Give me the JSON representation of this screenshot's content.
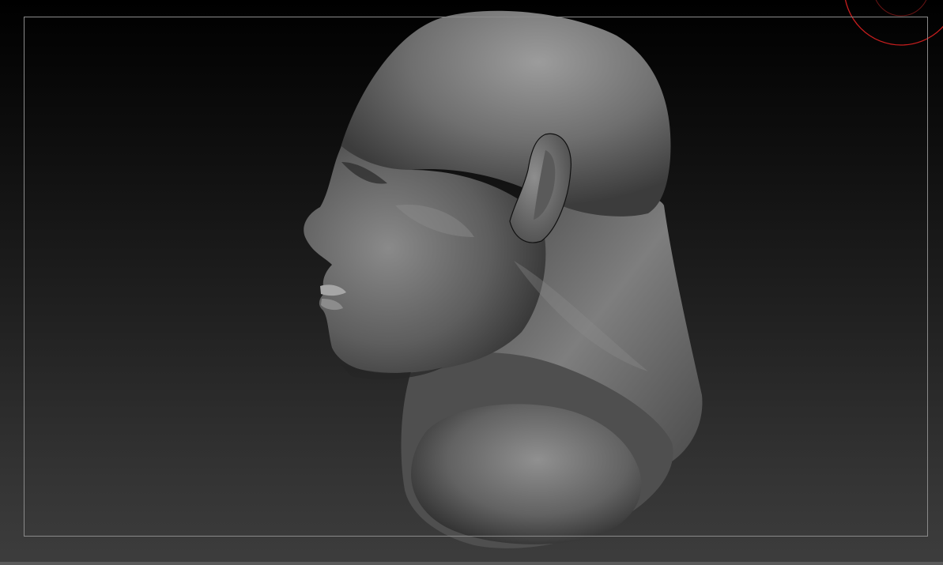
{
  "viewport": {
    "background_top": "#000000",
    "background_bottom": "#3d3d3d",
    "frame_color": "#8a8a8a"
  },
  "model": {
    "material_base": "#6b6b6b",
    "material_highlight": "#9a9a9a",
    "material_shadow": "#2a2a2a"
  },
  "brush_cursor": {
    "color": "#c81e1e",
    "icon": "brush-cursor-icon"
  }
}
